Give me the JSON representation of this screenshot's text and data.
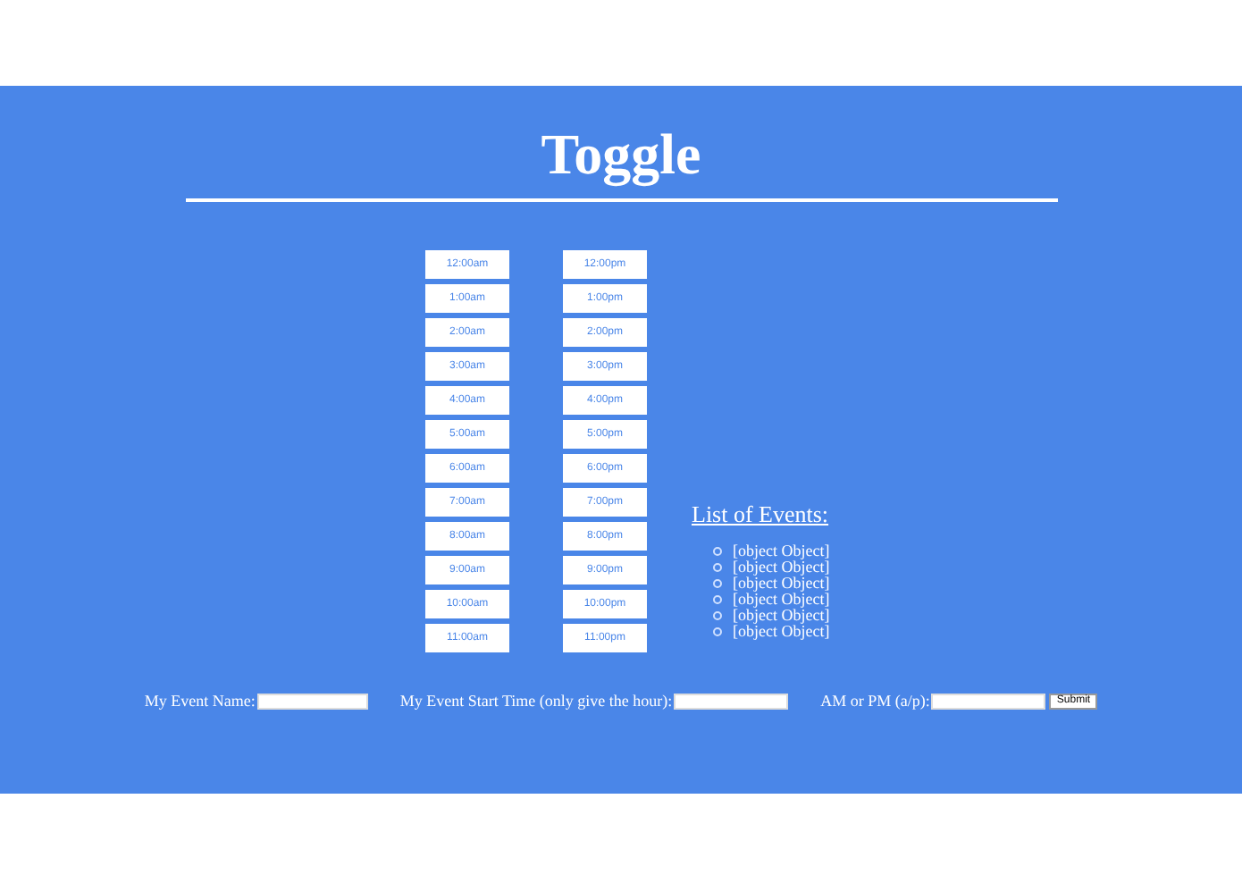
{
  "title": "Toggle",
  "am_times": [
    "12:00am",
    "1:00am",
    "2:00am",
    "3:00am",
    "4:00am",
    "5:00am",
    "6:00am",
    "7:00am",
    "8:00am",
    "9:00am",
    "10:00am",
    "11:00am"
  ],
  "pm_times": [
    "12:00pm",
    "1:00pm",
    "2:00pm",
    "3:00pm",
    "4:00pm",
    "5:00pm",
    "6:00pm",
    "7:00pm",
    "8:00pm",
    "9:00pm",
    "10:00pm",
    "11:00pm"
  ],
  "events": {
    "heading": "List of Events:",
    "items": [
      "[object Object]",
      "[object Object]",
      "[object Object]",
      "[object Object]",
      "[object Object]",
      "[object Object]"
    ]
  },
  "form": {
    "fields": [
      {
        "label": "My Event Name:"
      },
      {
        "label": "My Event Start Time (only give the hour):"
      },
      {
        "label": "AM or PM (a/p):"
      }
    ],
    "submit": "Submit"
  }
}
